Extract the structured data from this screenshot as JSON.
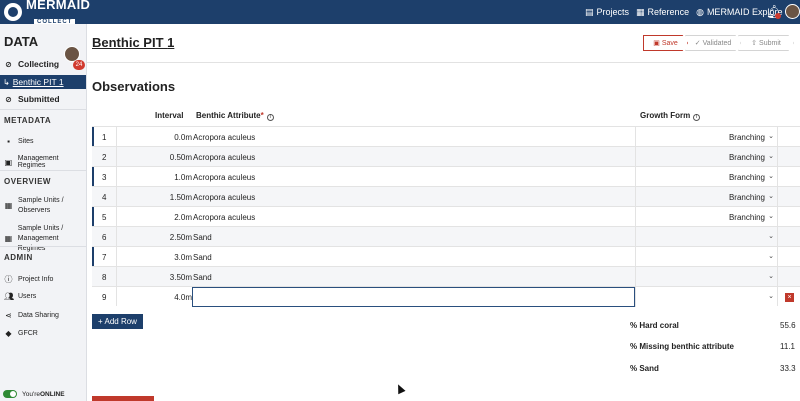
{
  "brand": {
    "title": "MERMAID",
    "subtitle": "COLLECT"
  },
  "topnav": {
    "projects": "Projects",
    "reference": "Reference",
    "explore": "MERMAID Explore"
  },
  "sidebar": {
    "title": "DATA",
    "badge": "24",
    "collecting": "Collecting",
    "active_item": "Benthic PIT 1",
    "submitted": "Submitted",
    "metadata_heading": "METADATA",
    "sites": "Sites",
    "management_regimes": "Management Regimes",
    "overview_heading": "OVERVIEW",
    "su_observers_1": "Sample Units /",
    "su_observers_2": "Observers",
    "su_regimes_1": "Sample Units /",
    "su_regimes_2": "Management Regimes",
    "admin_heading": "ADMIN",
    "project_info": "Project Info",
    "users": "Users",
    "data_sharing": "Data Sharing",
    "gfcr": "GFCR",
    "online_prefix": "You're ",
    "online_status": "ONLINE"
  },
  "page": {
    "title_prefix": "Benthic PIT ",
    "title_num": "1",
    "save": "Save",
    "validated": "Validated",
    "submit": "Submit",
    "observations": "Observations"
  },
  "table": {
    "headers": {
      "interval": "Interval",
      "attribute": "Benthic Attribute",
      "required": "*",
      "growth": "Growth Form"
    },
    "rows": [
      {
        "num": "1",
        "interval": "0.0m",
        "attribute": "Acropora aculeus",
        "growth": "Branching"
      },
      {
        "num": "2",
        "interval": "0.50m",
        "attribute": "Acropora aculeus",
        "growth": "Branching"
      },
      {
        "num": "3",
        "interval": "1.0m",
        "attribute": "Acropora aculeus",
        "growth": "Branching"
      },
      {
        "num": "4",
        "interval": "1.50m",
        "attribute": "Acropora aculeus",
        "growth": "Branching"
      },
      {
        "num": "5",
        "interval": "2.0m",
        "attribute": "Acropora aculeus",
        "growth": "Branching"
      },
      {
        "num": "6",
        "interval": "2.50m",
        "attribute": "Sand",
        "growth": ""
      },
      {
        "num": "7",
        "interval": "3.0m",
        "attribute": "Sand",
        "growth": ""
      },
      {
        "num": "8",
        "interval": "3.50m",
        "attribute": "Sand",
        "growth": ""
      },
      {
        "num": "9",
        "interval": "4.0m",
        "attribute": "",
        "growth": ""
      }
    ],
    "add_row": "+ Add Row"
  },
  "summary": [
    {
      "label": "% Hard coral",
      "value": "55.6"
    },
    {
      "label": "% Missing benthic attribute",
      "value": "11.1"
    },
    {
      "label": "% Sand",
      "value": "33.3"
    }
  ],
  "colors": {
    "navy": "#1d3f6b",
    "red": "#c0392b",
    "online_green": "#2f8a34"
  }
}
